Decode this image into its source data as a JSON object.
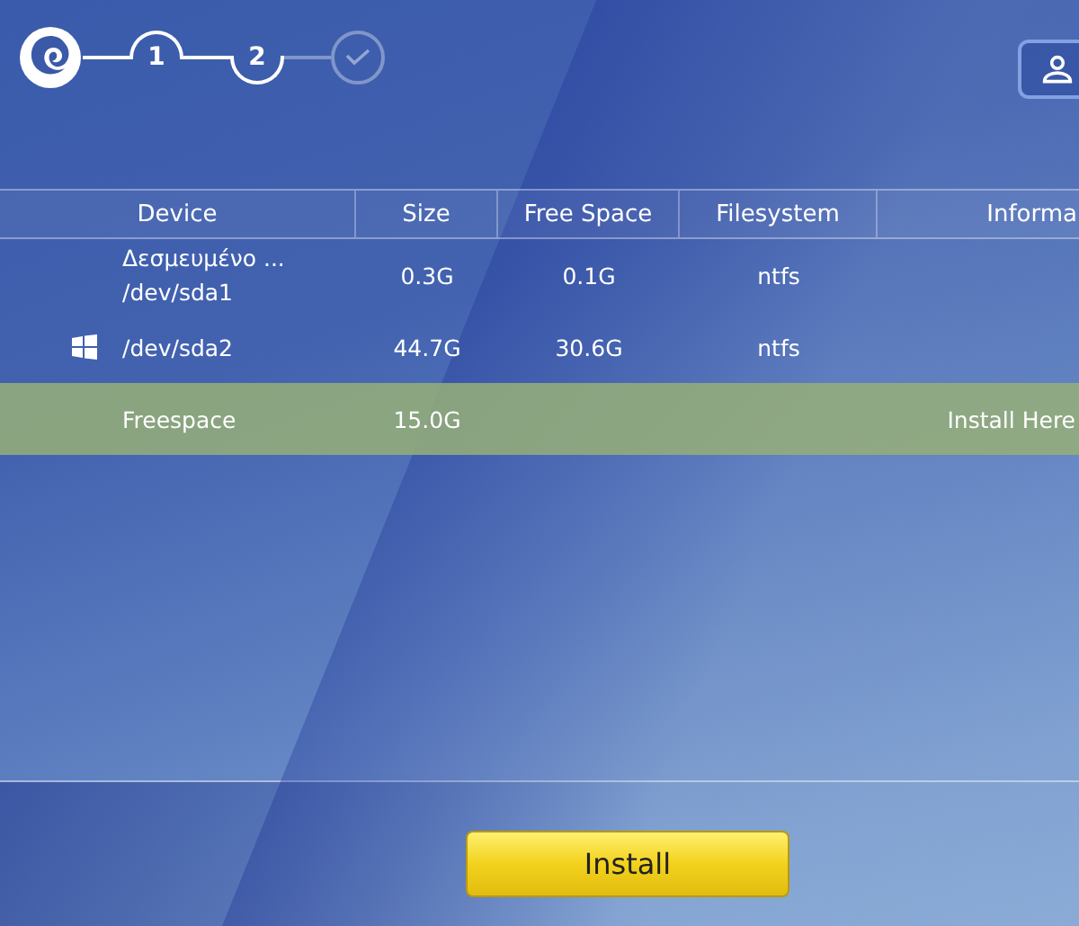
{
  "steps": [
    {
      "label": "1",
      "completed": true,
      "selected": false
    },
    {
      "label": "2",
      "completed": false,
      "selected": true
    },
    {
      "completed": false,
      "selected": false
    }
  ],
  "table": {
    "columns": [
      "Device",
      "Size",
      "Free Space",
      "Filesystem",
      "Informa"
    ],
    "rows": [
      {
        "has_os_icon": false,
        "label": "Δεσμευμένο ...",
        "device": "/dev/sda1",
        "size": "0.3G",
        "free_space": "0.1G",
        "filesystem": "ntfs",
        "selected": false
      },
      {
        "has_os_icon": true,
        "device": "/dev/sda2",
        "size": "44.7G",
        "free_space": "30.6G",
        "filesystem": "ntfs",
        "selected": false
      },
      {
        "has_os_icon": false,
        "device": "Freespace",
        "size": "15.0G",
        "info": "Install Here",
        "selected": true
      }
    ]
  },
  "install_button": "Install"
}
